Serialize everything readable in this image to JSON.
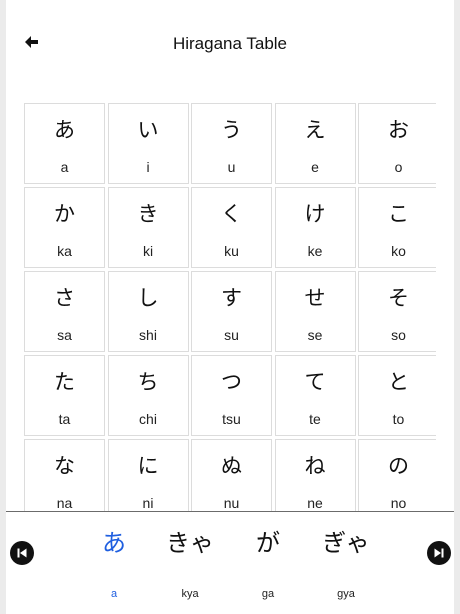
{
  "header": {
    "title": "Hiragana Table",
    "back_icon": "arrow-left-icon"
  },
  "grid": {
    "cells": [
      {
        "kana": "あ",
        "romaji": "a"
      },
      {
        "kana": "い",
        "romaji": "i"
      },
      {
        "kana": "う",
        "romaji": "u"
      },
      {
        "kana": "え",
        "romaji": "e"
      },
      {
        "kana": "お",
        "romaji": "o"
      },
      {
        "kana": "か",
        "romaji": "ka"
      },
      {
        "kana": "き",
        "romaji": "ki"
      },
      {
        "kana": "く",
        "romaji": "ku"
      },
      {
        "kana": "け",
        "romaji": "ke"
      },
      {
        "kana": "こ",
        "romaji": "ko"
      },
      {
        "kana": "さ",
        "romaji": "sa"
      },
      {
        "kana": "し",
        "romaji": "shi"
      },
      {
        "kana": "す",
        "romaji": "su"
      },
      {
        "kana": "せ",
        "romaji": "se"
      },
      {
        "kana": "そ",
        "romaji": "so"
      },
      {
        "kana": "た",
        "romaji": "ta"
      },
      {
        "kana": "ち",
        "romaji": "chi"
      },
      {
        "kana": "つ",
        "romaji": "tsu"
      },
      {
        "kana": "て",
        "romaji": "te"
      },
      {
        "kana": "と",
        "romaji": "to"
      },
      {
        "kana": "な",
        "romaji": "na"
      },
      {
        "kana": "に",
        "romaji": "ni"
      },
      {
        "kana": "ぬ",
        "romaji": "nu"
      },
      {
        "kana": "ね",
        "romaji": "ne"
      },
      {
        "kana": "の",
        "romaji": "no"
      }
    ]
  },
  "bottom_bar": {
    "prev_icon": "skip-previous-icon",
    "next_icon": "skip-next-icon",
    "tabs": [
      {
        "kana": "あ",
        "label": "a",
        "active": true
      },
      {
        "kana": "きゃ",
        "label": "kya",
        "active": false
      },
      {
        "kana": "が",
        "label": "ga",
        "active": false
      },
      {
        "kana": "ぎゃ",
        "label": "gya",
        "active": false
      }
    ]
  },
  "colors": {
    "accent": "#1f5fe0",
    "text": "#111111",
    "cell_border": "#dcdcdc",
    "background": "#ffffff"
  }
}
